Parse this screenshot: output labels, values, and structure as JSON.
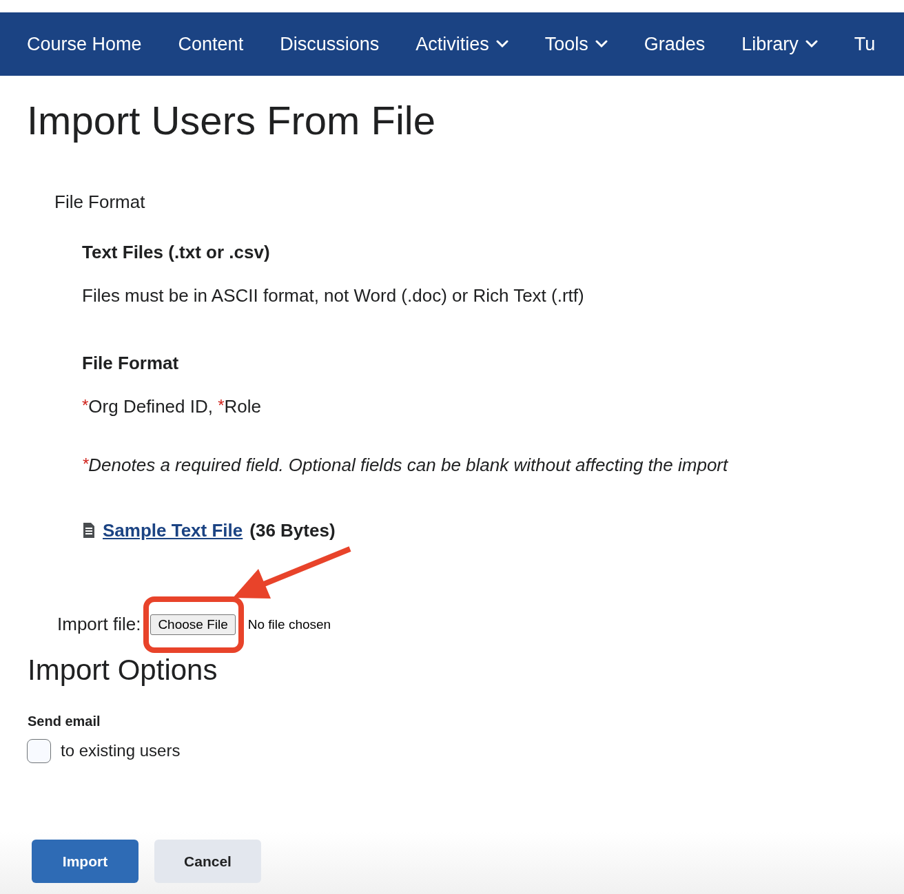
{
  "nav": [
    {
      "label": "Course Home",
      "has_menu": false
    },
    {
      "label": "Content",
      "has_menu": false
    },
    {
      "label": "Discussions",
      "has_menu": false
    },
    {
      "label": "Activities",
      "has_menu": true
    },
    {
      "label": "Tools",
      "has_menu": true
    },
    {
      "label": "Grades",
      "has_menu": false
    },
    {
      "label": "Library",
      "has_menu": true
    },
    {
      "label": "Tu",
      "has_menu": false
    }
  ],
  "title": "Import Users From File",
  "file_format": {
    "heading": "File Format",
    "subheading": "Text Files (.txt or .csv)",
    "description": "Files must be in ASCII format, not Word (.doc) or Rich Text (.rtf)",
    "format_heading": "File Format",
    "fields": [
      {
        "mark": "*",
        "label": "Org Defined ID,"
      },
      {
        "mark": "*",
        "label": "Role"
      }
    ],
    "note": {
      "mark": "*",
      "text": "Denotes a required field. Optional fields can be blank without affecting the import"
    },
    "sample": {
      "link": "Sample Text File",
      "size": "(36 Bytes)"
    }
  },
  "import_file": {
    "label": "Import file:",
    "button": "Choose File",
    "status": "No file chosen"
  },
  "options": {
    "heading": "Import Options",
    "group": "Send email",
    "checkbox": {
      "label": "to existing users",
      "checked": false
    }
  },
  "buttons": [
    {
      "label": "Import",
      "kind": "primary"
    },
    {
      "label": "Cancel",
      "kind": "secondary"
    }
  ]
}
